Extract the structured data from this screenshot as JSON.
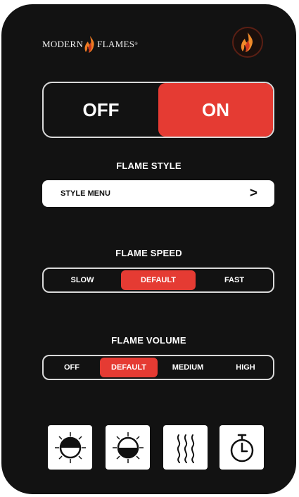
{
  "brand": {
    "left": "MODERN",
    "right": "FLAMES",
    "mark": "®"
  },
  "logo_button": {
    "icon": "flame-icon"
  },
  "power": {
    "off_label": "OFF",
    "on_label": "ON",
    "state": "ON"
  },
  "flame_style": {
    "title": "FLAME STYLE",
    "menu_label": "STYLE MENU",
    "chevron": ">"
  },
  "flame_speed": {
    "title": "FLAME SPEED",
    "options": [
      "SLOW",
      "DEFAULT",
      "FAST"
    ],
    "selected": "DEFAULT"
  },
  "flame_volume": {
    "title": "FLAME VOLUME",
    "options": [
      "OFF",
      "DEFAULT",
      "MEDIUM",
      "HIGH"
    ],
    "selected": "DEFAULT"
  },
  "bottom_icons": [
    "brightness-up-icon",
    "brightness-down-icon",
    "heat-icon",
    "timer-icon"
  ],
  "colors": {
    "accent": "#e53b33",
    "background": "#121212",
    "border": "#d9d9d9"
  }
}
